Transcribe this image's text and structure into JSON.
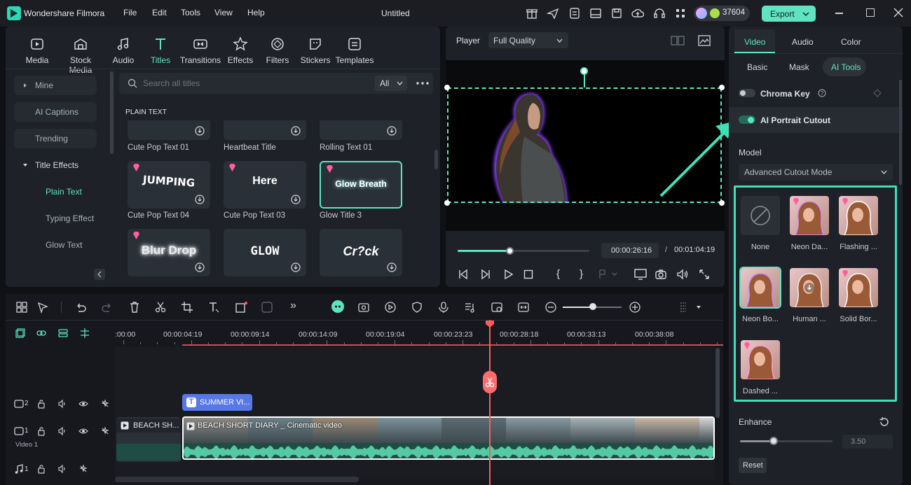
{
  "app": {
    "name": "Wondershare Filmora",
    "doc_title": "Untitled",
    "credits": "37604",
    "export_label": "Export"
  },
  "menu": [
    "File",
    "Edit",
    "Tools",
    "View",
    "Help"
  ],
  "library": {
    "tabs": [
      {
        "label": "Media",
        "icon": "media-icon"
      },
      {
        "label": "Stock Media",
        "icon": "stock-media-icon"
      },
      {
        "label": "Audio",
        "icon": "audio-icon"
      },
      {
        "label": "Titles",
        "icon": "titles-icon"
      },
      {
        "label": "Transitions",
        "icon": "transitions-icon"
      },
      {
        "label": "Effects",
        "icon": "effects-icon"
      },
      {
        "label": "Filters",
        "icon": "filters-icon"
      },
      {
        "label": "Stickers",
        "icon": "stickers-icon"
      },
      {
        "label": "Templates",
        "icon": "templates-icon"
      }
    ],
    "active_tab": "Titles",
    "sidebar": [
      "Mine",
      "AI Captions",
      "Trending",
      "Title Effects"
    ],
    "sidebar_sub": [
      "Plain Text",
      "Typing Effect",
      "Glow Text"
    ],
    "search_placeholder": "Search all titles",
    "filter": "All",
    "section": "PLAIN TEXT",
    "titles": [
      {
        "name": "Cute Pop Text 01",
        "text": ""
      },
      {
        "name": "Heartbeat Title",
        "text": ""
      },
      {
        "name": "Rolling Text 01",
        "text": ""
      },
      {
        "name": "Cute Pop Text 04",
        "text": "JUMPING"
      },
      {
        "name": "Cute Pop Text 03",
        "text": "Here"
      },
      {
        "name": "Glow Title 3",
        "text": "Glow Breath"
      },
      {
        "name": "",
        "text": "Blur Drop"
      },
      {
        "name": "",
        "text": "GLOW"
      },
      {
        "name": "",
        "text": "Cr?ck"
      }
    ]
  },
  "player": {
    "label": "Player",
    "quality": "Full Quality",
    "current_time": "00:00:26:16",
    "separator": "/",
    "total_time": "00:01:04:19",
    "progress": 0.4
  },
  "props": {
    "tabs": [
      "Video",
      "Audio",
      "Color"
    ],
    "subtabs": [
      "Basic",
      "Mask",
      "AI Tools"
    ],
    "chroma_key": "Chroma Key",
    "portrait_cutout": "AI Portrait Cutout",
    "model_label": "Model",
    "model_value": "Advanced Cutout Mode",
    "cutouts": [
      "None",
      "Neon Da...",
      "Flashing ...",
      "Neon Bo...",
      "Human ...",
      "Solid Bor...",
      "Dashed ..."
    ],
    "enhance_label": "Enhance",
    "enhance_value": "3.50",
    "reset_label": "Reset"
  },
  "timeline": {
    "ruler": [
      ":00:00",
      "00:00:04:19",
      "00:00:09:14",
      "00:00:14:09",
      "00:00:19:04",
      "00:00:23:23",
      "00:00:28:18",
      "00:00:33:13",
      "00:00:38:08"
    ],
    "tracks": {
      "track2": "2",
      "track1": "1",
      "video1": "Video 1",
      "audio1": "1"
    },
    "title_clip": "SUMMER VI...",
    "clip1": "BEACH SH...",
    "clip2": "BEACH SHORT DIARY _ Cinematic video"
  }
}
